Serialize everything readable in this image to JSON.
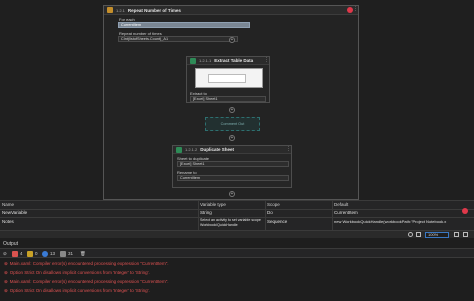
{
  "designer": {
    "repeat": {
      "id": "1.2.1",
      "title": "Repeat Number of Times",
      "for_each_label": "For each",
      "for_each_value": "CurrentItem",
      "repeat_label": "Repeat number of times",
      "repeat_value": "CInt(listofSheets.Count)_A1"
    },
    "extract": {
      "id": "1.2.1.1",
      "title": "Extract Table Data",
      "extract_to_label": "Extract to",
      "extract_to_value": "[Excel] Sheet1"
    },
    "comment_box": "Comment Out",
    "duplicate": {
      "id": "1.2.1.2",
      "title": "Duplicate Sheet",
      "sheet_label": "Sheet to duplicate",
      "sheet_value": "[Excel] Sheet1",
      "rename_label": "Rename to",
      "rename_value": "CurrentItem"
    }
  },
  "variables": {
    "headers": [
      "Name",
      "Variable type",
      "Scope",
      "Default"
    ],
    "rows": [
      {
        "name": "NewVariable",
        "type": "String",
        "scope": "Do",
        "default": "CurrentItem"
      },
      {
        "name": "Notes",
        "type": "Select an activity to set variable scope Workbook/QuickHandle",
        "scope": "Sequence",
        "default": "new WorkbookQuickHandle(workbookPath:\"Project Notebook.x"
      }
    ]
  },
  "toolbar": {
    "zoom": "100%"
  },
  "output": {
    "title": "Output",
    "filters": [
      {
        "icon": "error-icon",
        "count": "4",
        "color": "#d9534f"
      },
      {
        "icon": "warning-icon",
        "count": "0",
        "color": "#c9a227"
      },
      {
        "icon": "info-icon",
        "count": "13",
        "color": "#3a7bd5"
      },
      {
        "icon": "trace-icon",
        "count": "31",
        "color": "#888888"
      }
    ],
    "messages": [
      "Main.xaml: Compiler error(s) encountered processing expression \"CurrentItem\".",
      "Option Strict On disallows implicit conversions from 'Integer' to 'String'.",
      "Main.xaml: Compiler error(s) encountered processing expression \"CurrentItem\".",
      "Option Strict On disallows implicit conversions from 'Integer' to 'String'."
    ]
  },
  "colors": {
    "accent": "#3a78c2",
    "error": "#e05252",
    "selected_field": "#7a8693"
  }
}
